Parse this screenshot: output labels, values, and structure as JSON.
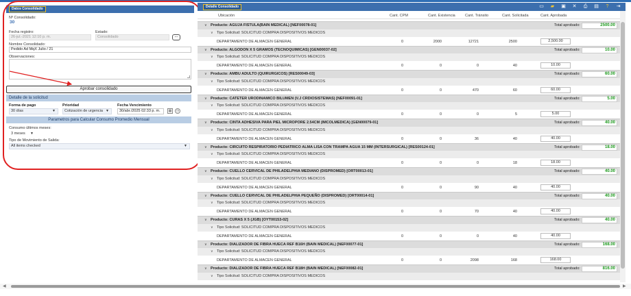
{
  "left": {
    "header_tag": "Datos Consolidado",
    "consolidado_label": "Nº Consolidado:",
    "consolidado_value": "30",
    "fecha_label": "Fecha registro:",
    "fecha_value": "26-jul.-2021 12:10 p. m.",
    "estado_label": "Estado:",
    "estado_value": "Consolidado",
    "estado_button": "...",
    "nombre_label": "Nombre Consolidado:",
    "nombre_value": "Pedido Ad MqX Julio / 21",
    "obs_label": "Observaciones:",
    "approve_button": "Aprobar consolidado",
    "detalle_title": "Detalle de la solicitud",
    "forma_pago_label": "Forma de pago",
    "forma_pago_value": "30 días",
    "prioridad_label": "Prioridad",
    "prioridad_value": "Cotización de urgencia",
    "fecha_venc_label": "Fecha Vencimiento",
    "fecha_venc_value": "30/abr./2025 02:33 p. m.",
    "params_title": "Parametros para Calcular Consumo Promedio Mensual",
    "consumo_label": "Consumo últimos meses:",
    "consumo_value": "3 meses",
    "tipo_mov_label": "Tipo de Movimiento de Salida:",
    "tipo_mov_value": "All items checked"
  },
  "right": {
    "header_tag": "Detalle Consolidado",
    "columns": {
      "ubicacion": "Ubicación",
      "cpm": "Cant. CPM",
      "existencia": "Cant. Existencia",
      "transito": "Cant. Tránsito",
      "solicitada": "Cant. Solicitada",
      "aprobada": "Cant. Aprobada"
    },
    "total_label": "Total aprobado:",
    "tipo_solicitud": "Tipo Solicitud: SOLICITUD COMPRA DISPOSITIVOS MEDICOS",
    "department": "DEPARTAMENTO DE ALMACEN GENERAL",
    "products": [
      {
        "name": "Producto: AGUJA FISTULA(BAIN MEDICAL) [NEF00078-01]",
        "total": "2500.00",
        "cpm": "0",
        "existencia": "2000",
        "transito": "12721",
        "solicitada": "2500",
        "aprobada": "2,500.00"
      },
      {
        "name": "Producto: ALGODON X 5 GRAMOS (TECNOQUIMICAS) [GEN00037-02]",
        "total": "10.00",
        "cpm": "0",
        "existencia": "0",
        "transito": "0",
        "solicitada": "40",
        "aprobada": "10.00"
      },
      {
        "name": "Producto: AMBU ADULTO (QUIRURGICOS) [RES00049-03]",
        "total": "60.00",
        "cpm": "0",
        "existencia": "0",
        "transito": "470",
        "solicitada": "60",
        "aprobada": "60.00"
      },
      {
        "name": "Producto: CATETER URODINAMICO BILUMEN (V.J CRDIOSISTEMAS) [NEF00091-01]",
        "total": "5.00",
        "cpm": "0",
        "existencia": "0",
        "transito": "0",
        "solicitada": "5",
        "aprobada": "5.00"
      },
      {
        "name": "Producto: CINTA ADHESIVA PARA PIEL MICROPORE 2.54CM (IMCOLMEDICA) [GEN00079-01]",
        "total": "40.00",
        "cpm": "0",
        "existencia": "0",
        "transito": "36",
        "solicitada": "40",
        "aprobada": "40.00"
      },
      {
        "name": "Producto: CIRCUITO RESPIRATORIO PEDIATRICO ALMA LISA CON TRAMPA AGUA 15 MM (INTERSURGICAL) [RES00124-01]",
        "total": "18.00",
        "cpm": "0",
        "existencia": "0",
        "transito": "0",
        "solicitada": "18",
        "aprobada": "18.00"
      },
      {
        "name": "Producto: CUELLO CERVICAL DE PHILADELPHIA MEDIANO (DISPROMED) [ORT00013-01]",
        "total": "40.00",
        "cpm": "0",
        "existencia": "0",
        "transito": "90",
        "solicitada": "40",
        "aprobada": "40.00"
      },
      {
        "name": "Producto: CUELLO CERVICAL DE PHILADELPHIA PEQUEÑO (DISPROMED) [ORT00014-01]",
        "total": "40.00",
        "cpm": "0",
        "existencia": "0",
        "transito": "70",
        "solicitada": "40",
        "aprobada": "40.00"
      },
      {
        "name": "Producto: CURAS X 5 (JGB) [OYT00153-02]",
        "total": "40.00",
        "cpm": "0",
        "existencia": "0",
        "transito": "0",
        "solicitada": "40",
        "aprobada": "40.00"
      },
      {
        "name": "Producto: DIALIZADOR DE FIBRA HUECA REF B16H (BAIN MEDICAL) [NEF00077-01]",
        "total": "168.00",
        "cpm": "0",
        "existencia": "0",
        "transito": "2098",
        "solicitada": "168",
        "aprobada": "168.00"
      },
      {
        "name": "Producto: DIALIZADOR DE FIBRA HUECA REF B18H (BAIN MEDICAL) [NEF00082-01]",
        "total": "816.00"
      }
    ]
  }
}
